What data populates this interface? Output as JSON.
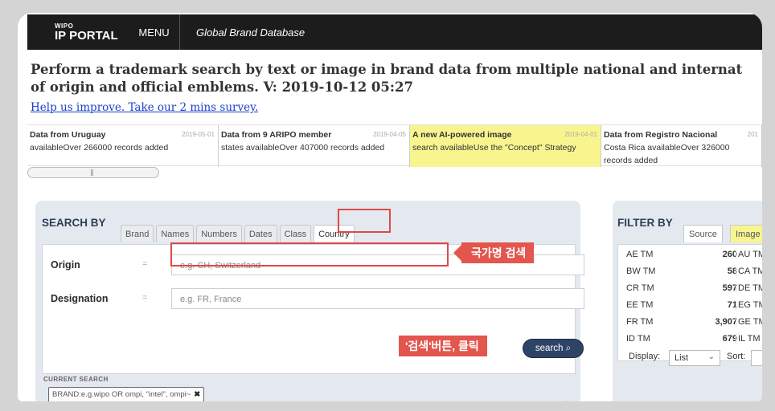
{
  "topbar": {
    "logo_small": "WIPO",
    "logo_big": "IP PORTAL",
    "menu": "MENU",
    "db_title": "Global Brand Database"
  },
  "headline": {
    "line1": "Perform a trademark search by text or image in brand data from multiple national and internat",
    "line2": "of origin and official emblems. V: 2019-10-12 05:27",
    "survey": "Help us improve. Take our 2 mins survey."
  },
  "news": [
    {
      "title": "Data from Uruguay",
      "text": "availableOver 266000 records added",
      "date": "2019-05-01"
    },
    {
      "title": "Data from 9 ARIPO member",
      "text": "states availableOver 407000 records added",
      "date": "2019-04-05"
    },
    {
      "title": "A new AI-powered image",
      "text": "search availableUse the \"Concept\" Strategy",
      "date": "2019-04-01"
    },
    {
      "title": "Data from Registro Nacional",
      "text": "Costa Rica availableOver 326000 records added",
      "date": "201"
    }
  ],
  "search": {
    "label": "SEARCH BY",
    "tabs": [
      "Brand",
      "Names",
      "Numbers",
      "Dates",
      "Class",
      "Country"
    ],
    "active_tab": "Country",
    "origin_label": "Origin",
    "origin_placeholder": "e.g. CH, Switzerland",
    "designation_label": "Designation",
    "designation_placeholder": "e.g. FR, France",
    "eq": "=",
    "button": "search",
    "callout_country": "국가명 검색",
    "callout_click": "'검색'버튼, 클릭"
  },
  "current_search": {
    "label": "CURRENT SEARCH",
    "chip": "BRAND:e.g.wipo OR ompi, \"intel\", ompi~",
    "remove": "✖"
  },
  "filter": {
    "label": "FILTER BY",
    "tabs": [
      "Source",
      "Image"
    ],
    "rows": [
      {
        "code": "AE TM",
        "count": "260",
        "code2": "AU TM"
      },
      {
        "code": "BW TM",
        "count": "58",
        "code2": "CA TM"
      },
      {
        "code": "CR TM",
        "count": "597",
        "code2": "DE TM"
      },
      {
        "code": "EE TM",
        "count": "71",
        "code2": "EG TM"
      },
      {
        "code": "FR TM",
        "count": "3,907",
        "code2": "GE TM"
      },
      {
        "code": "ID TM",
        "count": "679",
        "code2": "IL TM"
      }
    ],
    "display_label": "Display:",
    "display_value": "List",
    "sort_label": "Sort:"
  }
}
